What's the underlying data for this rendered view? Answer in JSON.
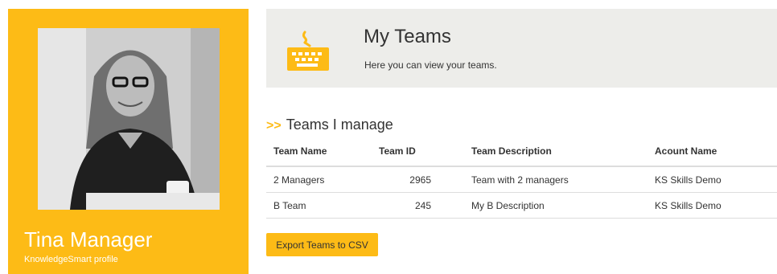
{
  "profile": {
    "name": "Tina Manager",
    "subtitle": "KnowledgeSmart profile"
  },
  "header": {
    "icon": "keyboard-coffee-icon",
    "title": "My Teams",
    "subtitle": "Here you can view your teams."
  },
  "section": {
    "arrows": ">>",
    "title": "Teams I manage"
  },
  "table": {
    "columns": [
      "Team Name",
      "Team ID",
      "Team Description",
      "Acount Name"
    ],
    "rows": [
      {
        "name": "2 Managers",
        "id": "2965",
        "description": "Team with 2 managers",
        "account": "KS Skills Demo"
      },
      {
        "name": "B Team",
        "id": "245",
        "description": "My B Description",
        "account": "KS Skills Demo"
      }
    ]
  },
  "actions": {
    "export_label": "Export Teams to CSV"
  },
  "colors": {
    "accent": "#fdbb16",
    "header_bg": "#ededea"
  }
}
